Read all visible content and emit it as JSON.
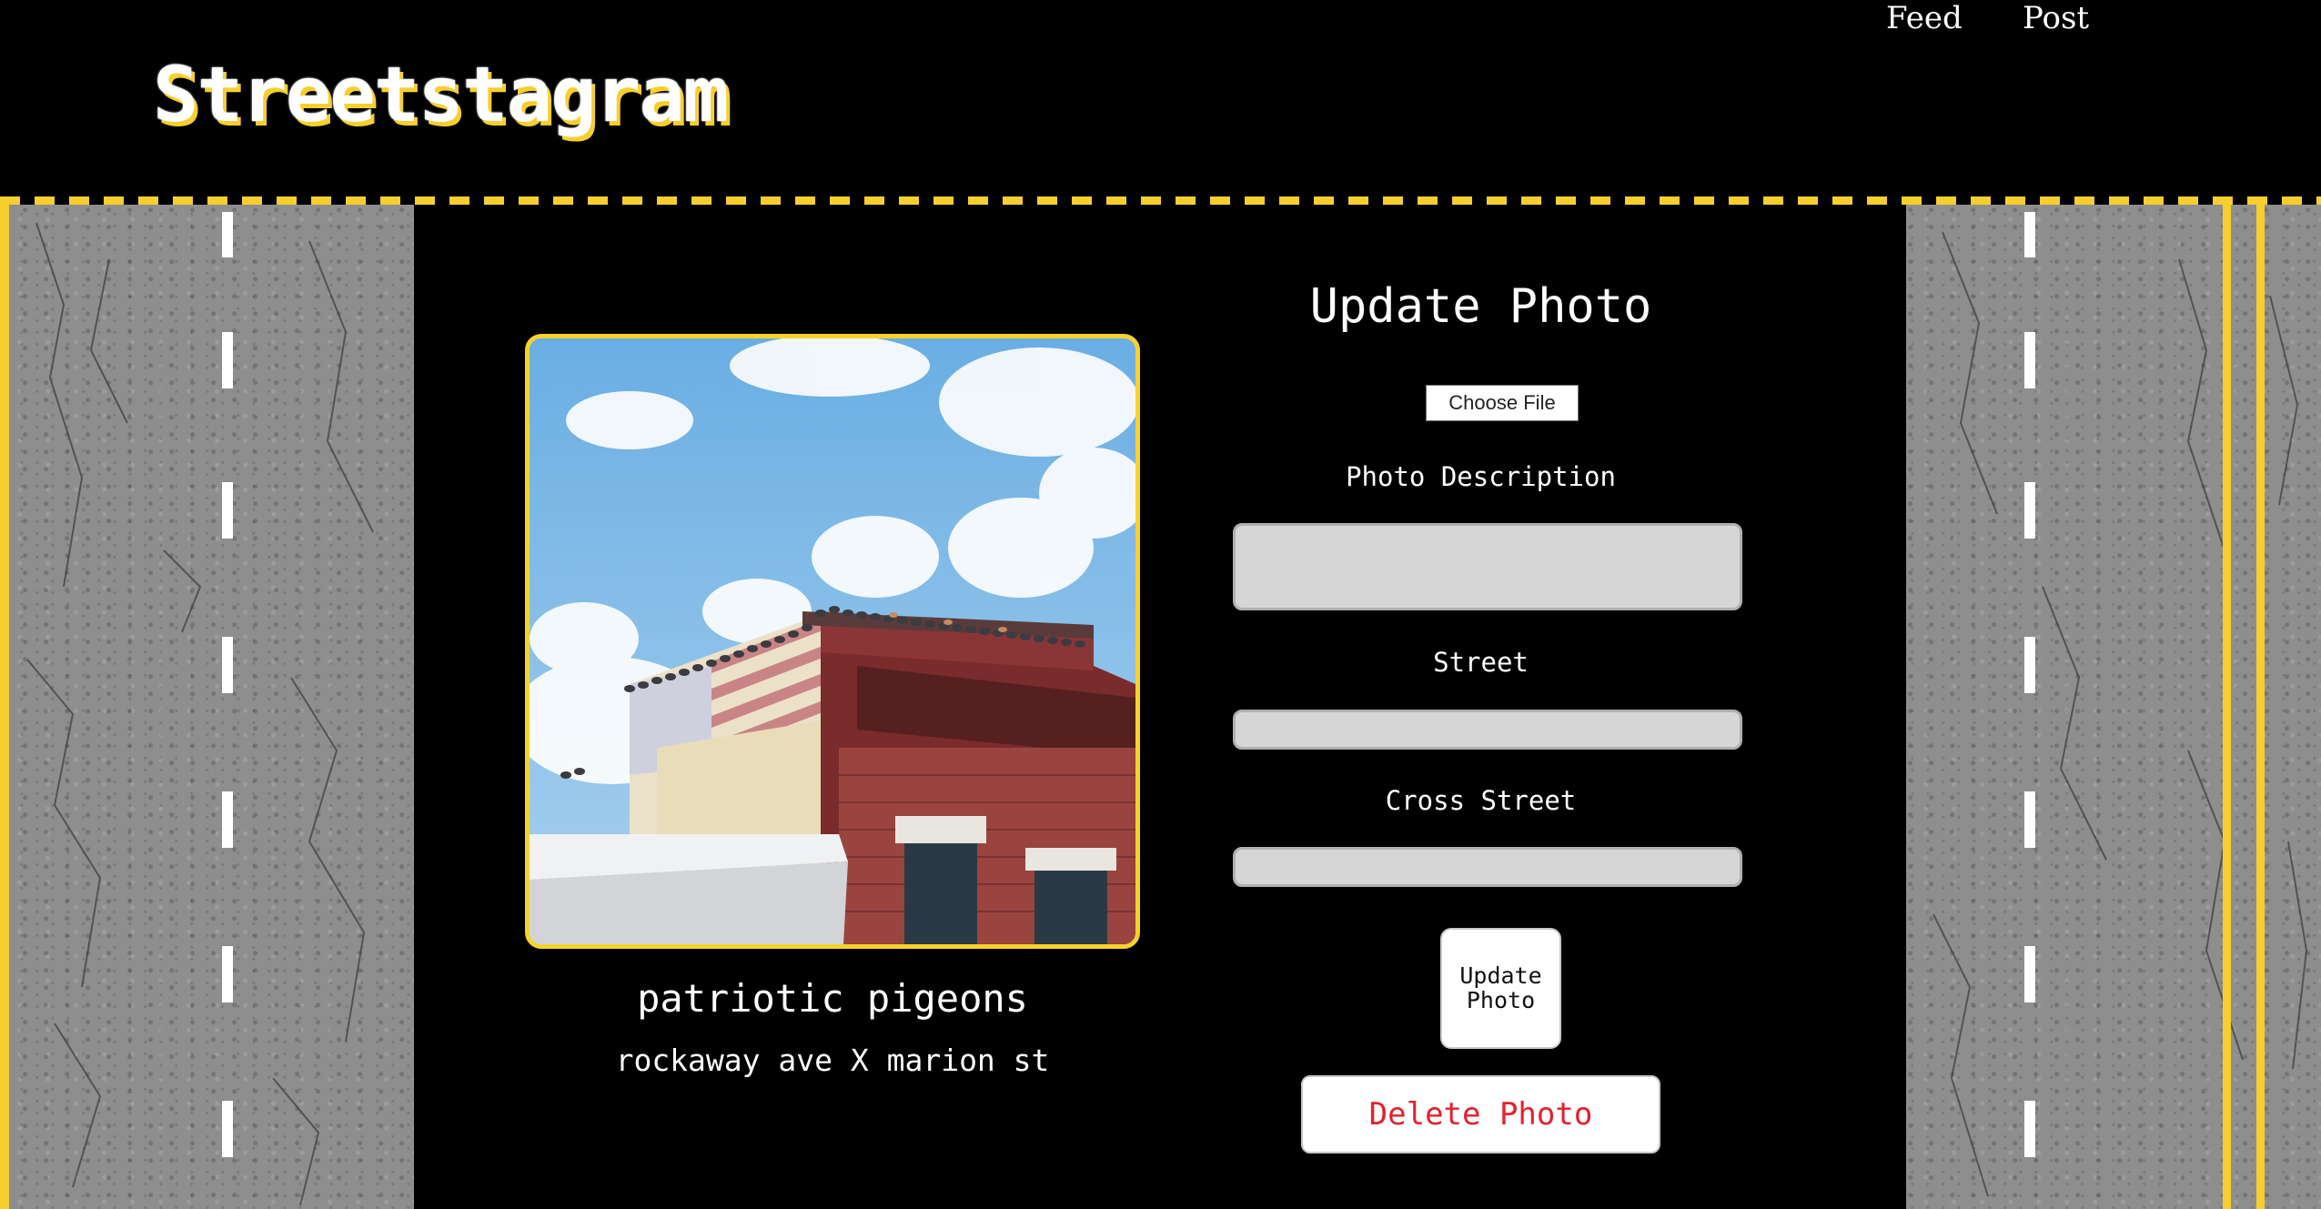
{
  "app": {
    "brand": "Streetstagram",
    "colors": {
      "accent": "#f6cf2e",
      "background": "#000000",
      "delete": "#e5202d"
    }
  },
  "nav": {
    "feed": "Feed",
    "post": "Post"
  },
  "photo": {
    "description": "patriotic pigeons",
    "location": "rockaway ave X marion st"
  },
  "form": {
    "title": "Update Photo",
    "file_button": "Choose File",
    "description_label": "Photo Description",
    "description_value": "",
    "street_label": "Street",
    "street_value": "",
    "cross_street_label": "Cross Street",
    "cross_street_value": "",
    "update_button": "Update Photo",
    "delete_button": "Delete Photo"
  }
}
